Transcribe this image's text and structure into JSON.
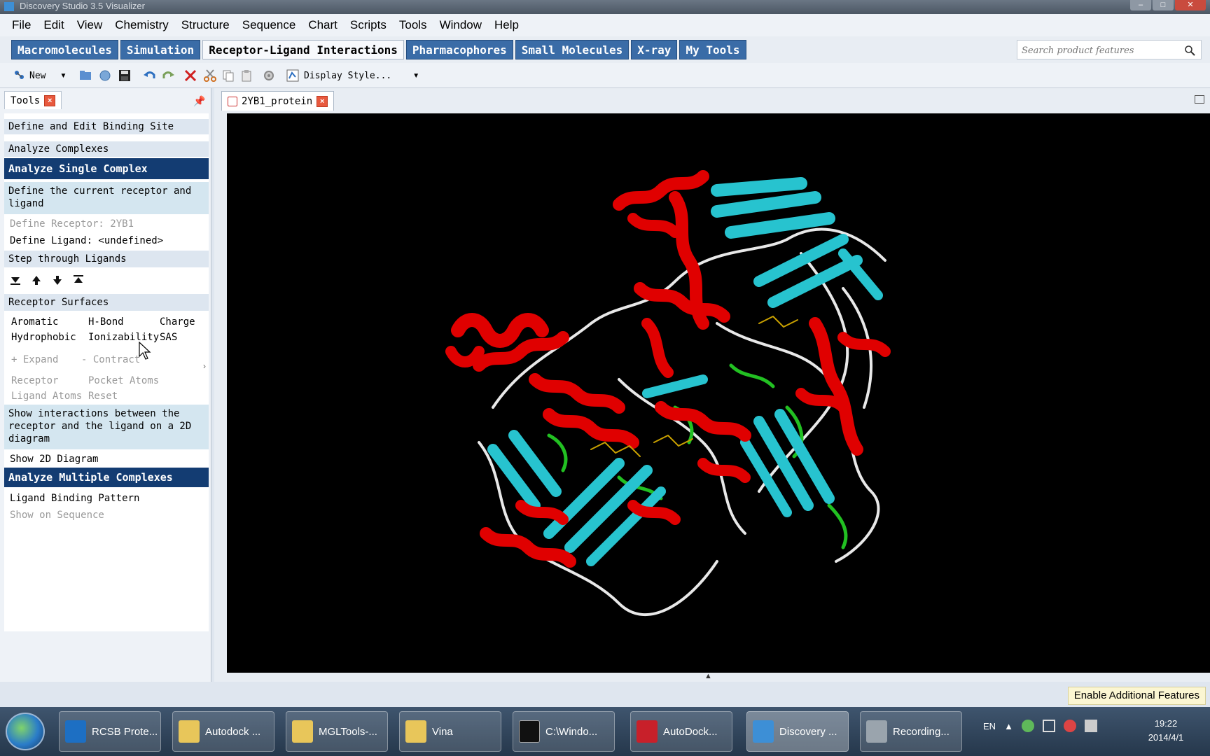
{
  "window": {
    "title": "Discovery Studio 3.5 Visualizer"
  },
  "menu": [
    "File",
    "Edit",
    "View",
    "Chemistry",
    "Structure",
    "Sequence",
    "Chart",
    "Scripts",
    "Tools",
    "Window",
    "Help"
  ],
  "ribbon_tabs": [
    {
      "label": "Macromolecules",
      "active": false
    },
    {
      "label": "Simulation",
      "active": false
    },
    {
      "label": "Receptor-Ligand Interactions",
      "active": true
    },
    {
      "label": "Pharmacophores",
      "active": false
    },
    {
      "label": "Small Molecules",
      "active": false
    },
    {
      "label": "X-ray",
      "active": false
    },
    {
      "label": "My Tools",
      "active": false
    }
  ],
  "search": {
    "placeholder": "Search product features"
  },
  "toolbar": {
    "new_label": "New",
    "display_style_label": "Display Style..."
  },
  "tools_panel": {
    "tab_label": "Tools",
    "define_edit_binding_site": "Define and Edit Binding Site",
    "analyze_complexes": "Analyze Complexes",
    "analyze_single_complex": "Analyze Single Complex",
    "define_receptor_desc": "Define the current receptor and ligand",
    "define_receptor": "Define Receptor: 2YB1",
    "define_ligand": "Define Ligand: <undefined>",
    "step_through_ligands": "Step through Ligands",
    "receptor_surfaces": "Receptor Surfaces",
    "surfaces_row1": [
      "Aromatic",
      "H-Bond",
      "Charge"
    ],
    "surfaces_row2": [
      "Hydrophobic",
      "Ionizability",
      "SAS"
    ],
    "expand": "+ Expand",
    "contract": "- Contract",
    "receptor": "Receptor",
    "pocket_atoms": "Pocket Atoms",
    "ligand_atoms": "Ligand Atoms",
    "reset": "Reset",
    "show_interactions_desc": "Show interactions between the receptor and the ligand on a 2D diagram",
    "show_2d_diagram": "Show 2D Diagram",
    "analyze_multiple_complexes": "Analyze Multiple Complexes",
    "ligand_binding_pattern": "Ligand Binding Pattern",
    "show_on_sequence": "Show on Sequence"
  },
  "document_tab": {
    "label": "2YB1_protein"
  },
  "status": {
    "enable_features_label": "Enable Additional Features"
  },
  "taskbar": {
    "tasks": [
      {
        "label": "RCSB Prote...",
        "icon": "rcsb-icon",
        "active": false
      },
      {
        "label": "Autodock ...",
        "icon": "folder-icon",
        "active": false
      },
      {
        "label": "MGLTools-...",
        "icon": "folder-icon",
        "active": false
      },
      {
        "label": "Vina",
        "icon": "folder-icon",
        "active": false
      },
      {
        "label": "C:\\Windo...",
        "icon": "cmd-icon",
        "active": false
      },
      {
        "label": "AutoDock...",
        "icon": "autodock-icon",
        "active": false
      },
      {
        "label": "Discovery ...",
        "icon": "discovery-icon",
        "active": true
      },
      {
        "label": "Recording...",
        "icon": "recording-icon",
        "active": false
      }
    ],
    "language": "EN",
    "time": "19:22",
    "date": "2014/4/1"
  },
  "colors": {
    "helix": "#e00000",
    "sheet": "#27c3cf",
    "coil": "#e8e8e8",
    "turn": "#22c022",
    "header_blue": "#133c72",
    "tab_blue": "#3a6ca7"
  }
}
